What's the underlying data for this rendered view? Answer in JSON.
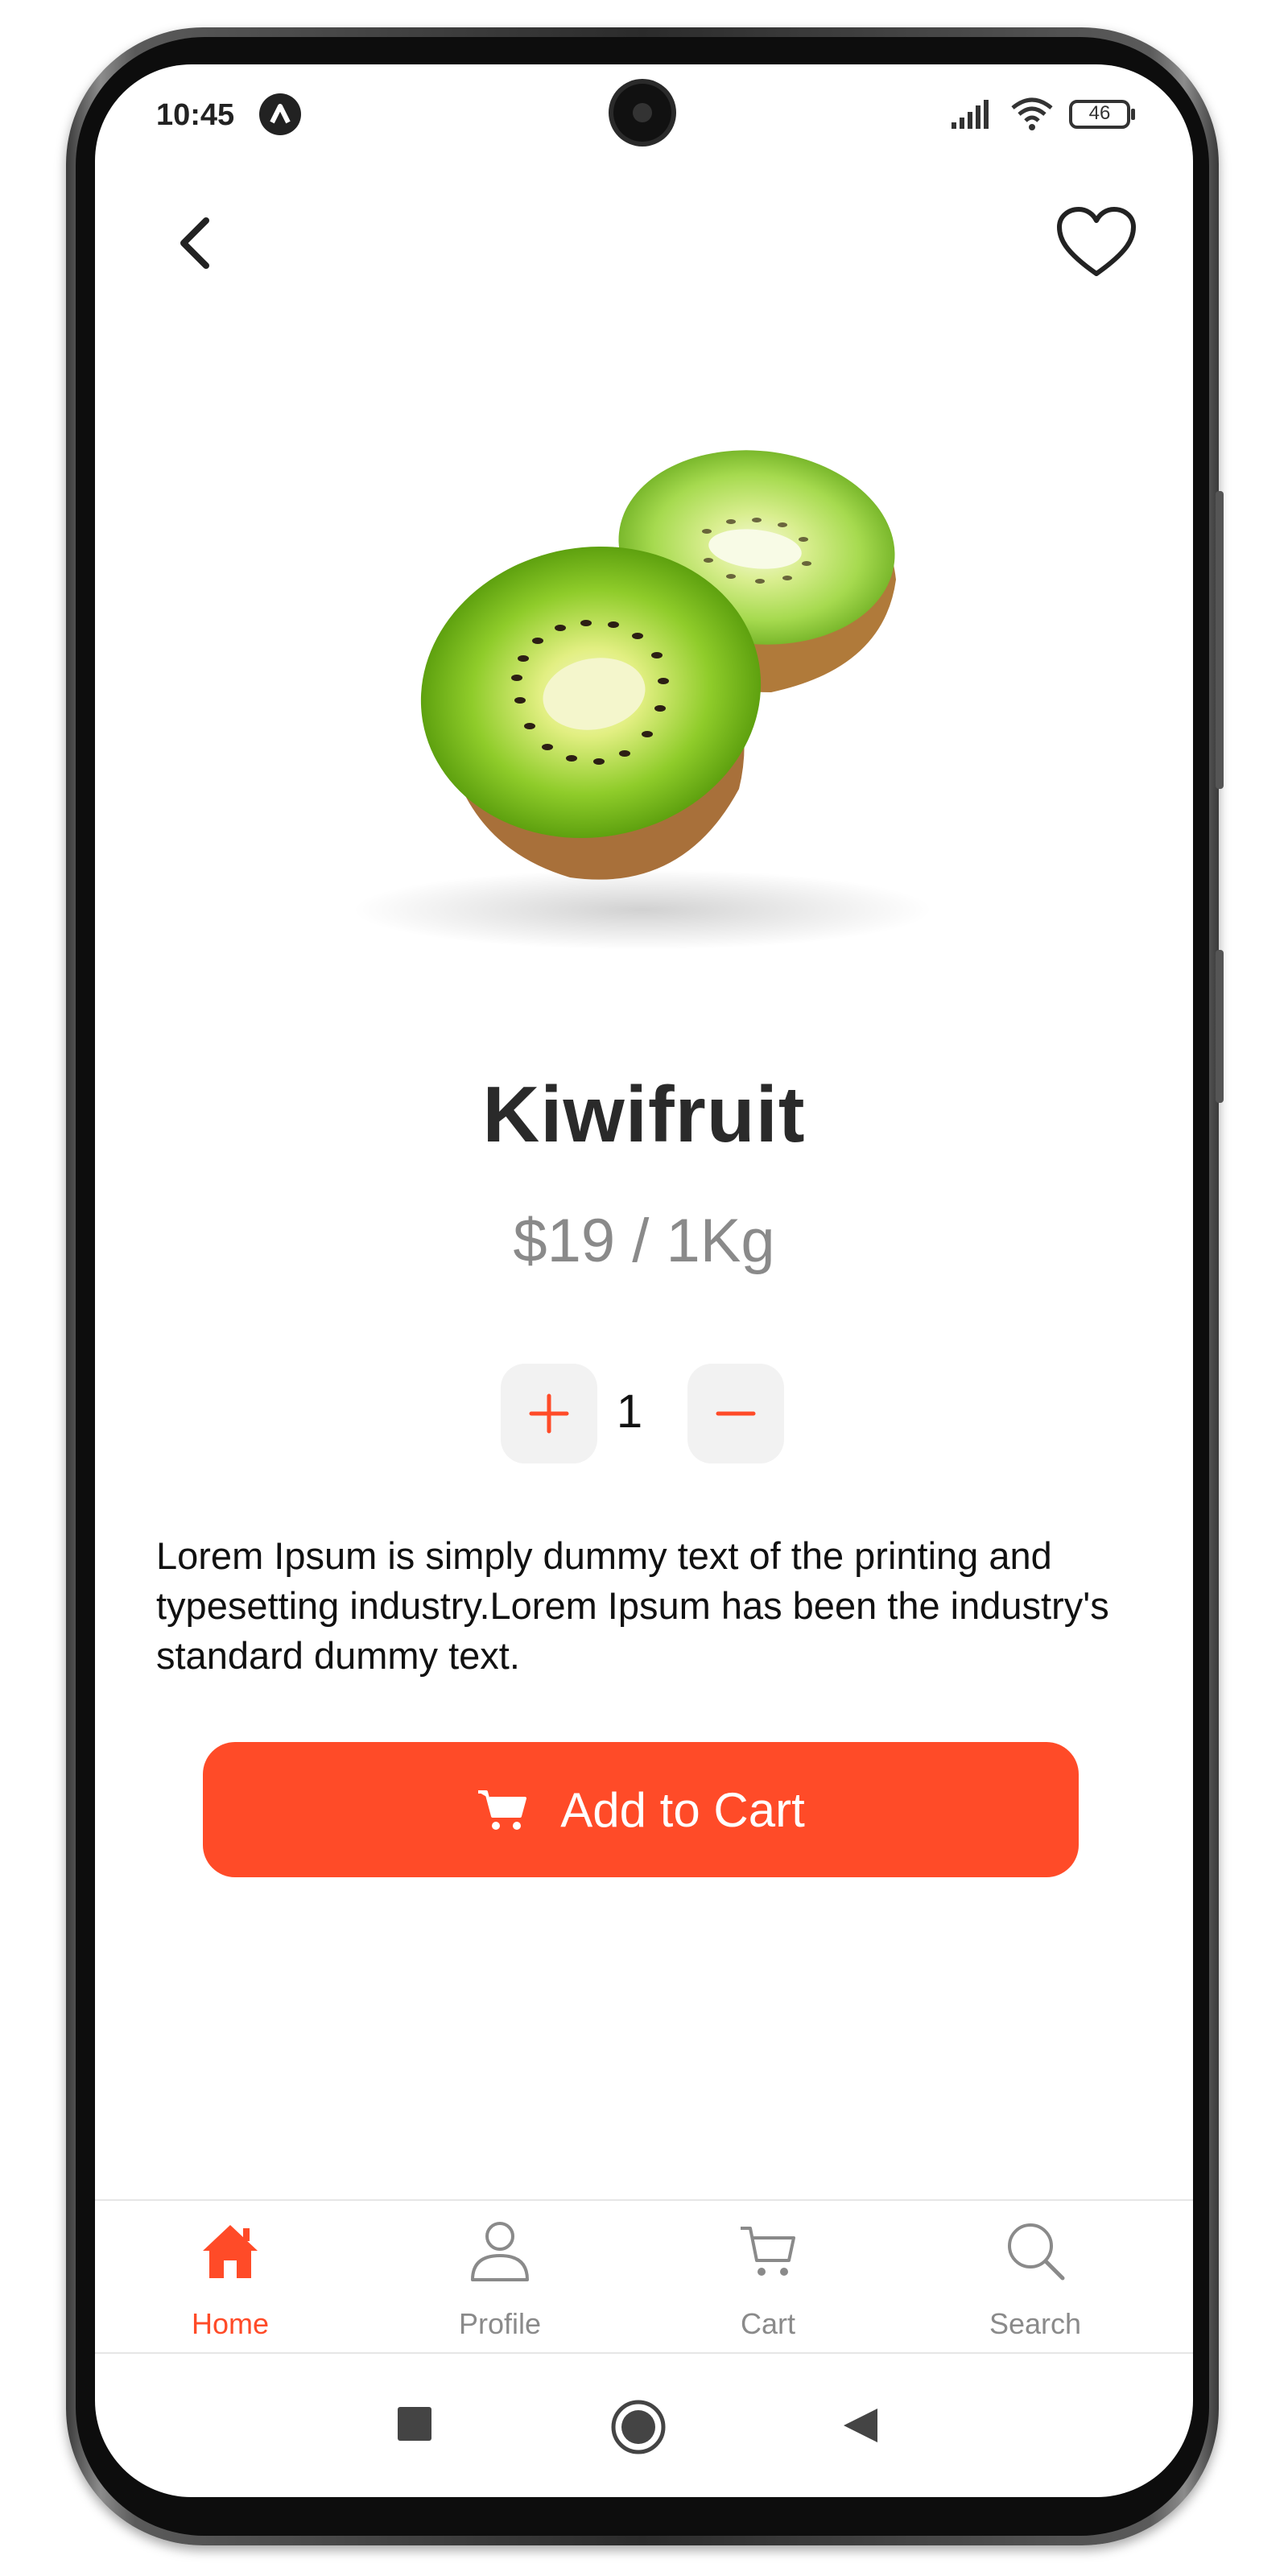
{
  "status_bar": {
    "time": "10:45",
    "badge_letter": "Λ",
    "battery": "46"
  },
  "product": {
    "name": "Kiwifruit",
    "price": "$19 / 1Kg",
    "quantity": "1",
    "description": "Lorem Ipsum is simply dummy text of the printing and typesetting industry.Lorem Ipsum has been the industry's standard dummy text."
  },
  "actions": {
    "add_to_cart": "Add to Cart"
  },
  "tabs": [
    {
      "label": "Home",
      "icon": "home-icon",
      "active": true
    },
    {
      "label": "Profile",
      "icon": "profile-icon",
      "active": false
    },
    {
      "label": "Cart",
      "icon": "cart-icon",
      "active": false
    },
    {
      "label": "Search",
      "icon": "search-icon",
      "active": false
    }
  ],
  "colors": {
    "accent": "#ff4b28",
    "muted": "#8a8a8a",
    "text": "#2a2a2a"
  }
}
